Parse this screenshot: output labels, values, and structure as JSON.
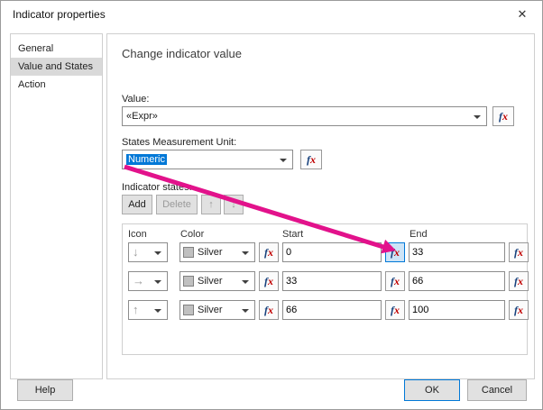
{
  "window": {
    "title": "Indicator properties"
  },
  "sidebar": {
    "items": [
      {
        "label": "General"
      },
      {
        "label": "Value and States"
      },
      {
        "label": "Action"
      }
    ]
  },
  "main": {
    "heading": "Change indicator value",
    "value": {
      "label": "Value:",
      "selected": "«Expr»"
    },
    "unit": {
      "label": "States Measurement Unit:",
      "selected": "Numeric"
    },
    "states": {
      "label": "Indicator states:",
      "add_label": "Add",
      "delete_label": "Delete",
      "table": {
        "headers": [
          "Icon",
          "Color",
          "Start",
          "End"
        ],
        "rows": [
          {
            "icon": "down-arrow",
            "icon_glyph": "↓",
            "color": "Silver",
            "start": "0",
            "end": "33"
          },
          {
            "icon": "right-arrow",
            "icon_glyph": "→",
            "color": "Silver",
            "start": "33",
            "end": "66"
          },
          {
            "icon": "up-arrow",
            "icon_glyph": "↑",
            "color": "Silver",
            "start": "66",
            "end": "100"
          }
        ]
      }
    }
  },
  "footer": {
    "help": "Help",
    "ok": "OK",
    "cancel": "Cancel"
  },
  "icons": {
    "close": "✕",
    "fx": "fx",
    "move_up": "↑",
    "move_down": "↓"
  },
  "colors": {
    "accent": "#0078d7",
    "selection": "#0078d7",
    "annotation_arrow": "#e2128b",
    "silver_swatch": "#c0c0c0"
  }
}
